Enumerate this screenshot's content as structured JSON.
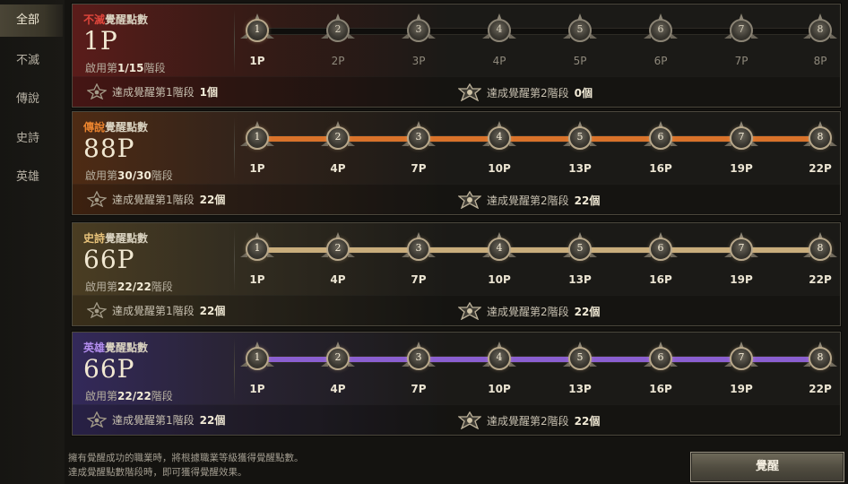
{
  "sidebar": {
    "tabs": [
      {
        "label": "全部",
        "active": true
      },
      {
        "label": "不滅",
        "active": false
      },
      {
        "label": "傳說",
        "active": false
      },
      {
        "label": "史詩",
        "active": false
      },
      {
        "label": "英雄",
        "active": false
      }
    ]
  },
  "panels": [
    {
      "grade": "不滅",
      "title_suffix": "覺醒點數",
      "grade_color": "#e0463c",
      "glow": "linear-gradient(90deg, #5a1c1a 0%, #3a1b16 40%, rgba(27,26,23,0) 100%)",
      "fill_color": "#3a3630",
      "fill_fraction": 0,
      "points": "1P",
      "enable_prefix": "啟用第",
      "enable_value": "1/15",
      "enable_suffix": "階段",
      "steps": [
        "1P",
        "2P",
        "3P",
        "4P",
        "5P",
        "6P",
        "7P",
        "8P"
      ],
      "lit_count": 1,
      "ach1_label": "達成覺醒第1階段",
      "ach1_count": "1個",
      "ach2_label": "達成覺醒第2階段",
      "ach2_count": "0個"
    },
    {
      "grade": "傳說",
      "title_suffix": "覺醒點數",
      "grade_color": "#e9832e",
      "glow": "linear-gradient(90deg, #4e2b14 0%, #35241a 40%, rgba(27,26,23,0) 100%)",
      "fill_color": "#d9722a",
      "fill_fraction": 1,
      "points": "88P",
      "enable_prefix": "啟用第",
      "enable_value": "30/30",
      "enable_suffix": "階段",
      "steps": [
        "1P",
        "4P",
        "7P",
        "10P",
        "13P",
        "16P",
        "19P",
        "22P"
      ],
      "lit_count": 8,
      "ach1_label": "達成覺醒第1階段",
      "ach1_count": "22個",
      "ach2_label": "達成覺醒第2階段",
      "ach2_count": "22個"
    },
    {
      "grade": "史詩",
      "title_suffix": "覺醒點數",
      "grade_color": "#e7c27a",
      "glow": "linear-gradient(90deg, #4a3d22 0%, #342e21 40%, rgba(27,26,23,0) 100%)",
      "fill_color": "#c9ad7c",
      "fill_fraction": 1,
      "points": "66P",
      "enable_prefix": "啟用第",
      "enable_value": "22/22",
      "enable_suffix": "階段",
      "steps": [
        "1P",
        "4P",
        "7P",
        "10P",
        "13P",
        "16P",
        "19P",
        "22P"
      ],
      "lit_count": 8,
      "ach1_label": "達成覺醒第1階段",
      "ach1_count": "22個",
      "ach2_label": "達成覺醒第2階段",
      "ach2_count": "22個"
    },
    {
      "grade": "英雄",
      "title_suffix": "覺醒點數",
      "grade_color": "#b48ef0",
      "glow": "linear-gradient(90deg, #33295a 0%, #2a2436 40%, rgba(27,26,23,0) 100%)",
      "fill_color": "#8a5fd0",
      "fill_fraction": 1,
      "points": "66P",
      "enable_prefix": "啟用第",
      "enable_value": "22/22",
      "enable_suffix": "階段",
      "steps": [
        "1P",
        "4P",
        "7P",
        "10P",
        "13P",
        "16P",
        "19P",
        "22P"
      ],
      "lit_count": 8,
      "ach1_label": "達成覺醒第1階段",
      "ach1_count": "22個",
      "ach2_label": "達成覺醒第2階段",
      "ach2_count": "22個"
    }
  ],
  "footer": {
    "line1": "擁有覺醒成功的職業時，將根據職業等級獲得覺醒點數。",
    "line2": "達成覺醒點數階段時，即可獲得覺醒效果。"
  },
  "awaken_button": "覺醒"
}
